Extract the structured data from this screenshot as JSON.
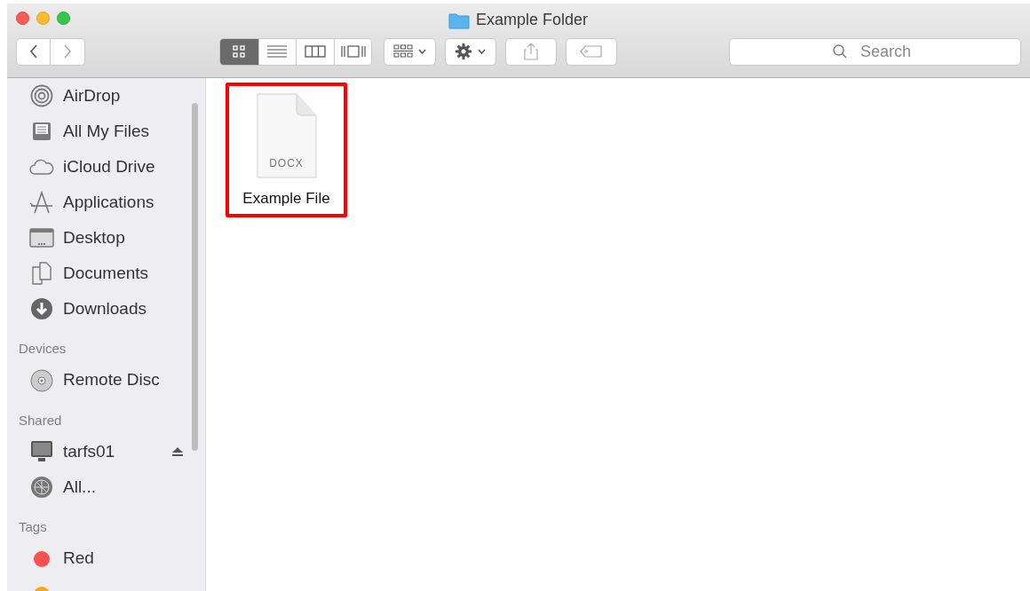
{
  "window": {
    "title": "Example Folder"
  },
  "toolbar": {
    "views": [
      {
        "kind": "icons",
        "selected": true
      },
      {
        "kind": "list",
        "selected": false
      },
      {
        "kind": "columns",
        "selected": false
      },
      {
        "kind": "coverflow",
        "selected": false
      }
    ],
    "search": {
      "placeholder": "Search"
    }
  },
  "sidebar": {
    "sections": [
      {
        "items": [
          {
            "label": "AirDrop",
            "kind": "airdrop"
          },
          {
            "label": "All My Files",
            "kind": "allfiles"
          },
          {
            "label": "iCloud Drive",
            "kind": "cloud"
          },
          {
            "label": "Applications",
            "kind": "apps"
          },
          {
            "label": "Desktop",
            "kind": "desktop"
          },
          {
            "label": "Documents",
            "kind": "documents"
          },
          {
            "label": "Downloads",
            "kind": "downloads"
          }
        ]
      },
      {
        "title": "Devices",
        "items": [
          {
            "label": "Remote Disc",
            "kind": "disc"
          }
        ]
      },
      {
        "title": "Shared",
        "items": [
          {
            "label": "tarfs01",
            "kind": "computer",
            "ejectable": true
          },
          {
            "label": "All...",
            "kind": "network"
          }
        ]
      },
      {
        "title": "Tags",
        "items": [
          {
            "label": "Red",
            "kind": "tag",
            "color": "#fc4f4f"
          },
          {
            "kind": "tag",
            "color": "#f5a623"
          }
        ]
      }
    ]
  },
  "files": [
    {
      "name": "Example File",
      "type_label": "DOCX",
      "highlighted": true
    }
  ]
}
